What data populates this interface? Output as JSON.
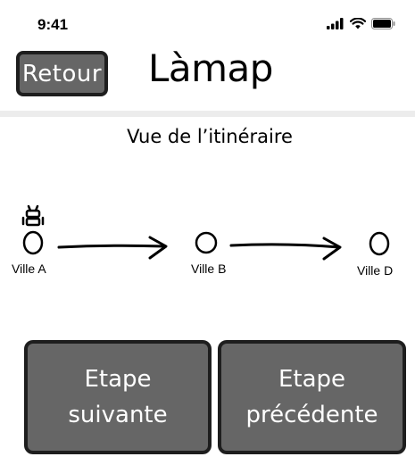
{
  "status_bar": {
    "time": "9:41",
    "icons": [
      "signal-icon",
      "wifi-icon",
      "battery-icon"
    ]
  },
  "header": {
    "back_label": "Retour",
    "title": "Làmap"
  },
  "itinerary": {
    "title": "Vue de l’itinéraire",
    "stops": [
      {
        "label": "Ville A",
        "current": true
      },
      {
        "label": "Ville B",
        "current": false
      },
      {
        "label": "Ville D",
        "current": false
      }
    ],
    "current_marker_icon": "robot-icon"
  },
  "actions": {
    "next": {
      "line1": "Etape",
      "line2": "suivante"
    },
    "previous": {
      "line1": "Etape",
      "line2": "précédente"
    }
  },
  "colors": {
    "button_fill": "#666666",
    "button_border": "#1e1e1e",
    "divider": "#ececec"
  }
}
